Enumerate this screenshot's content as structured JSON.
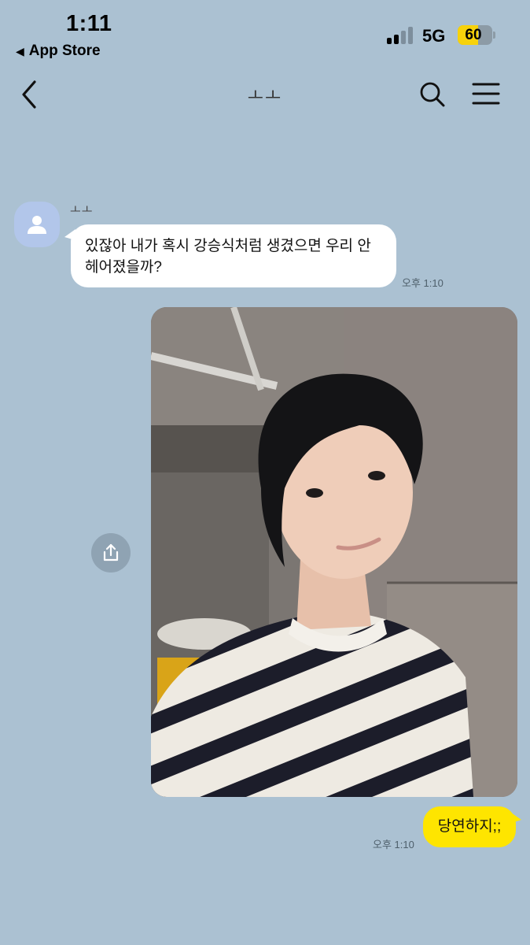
{
  "status_bar": {
    "time": "1:11",
    "back_app": "App Store",
    "network": "5G",
    "battery": "60",
    "battery_level": 0.6
  },
  "header": {
    "title": "ㅗㅗ"
  },
  "messages": [
    {
      "sender": "ㅗㅗ",
      "text": "있잖아 내가 혹시 강승식처럼 생겼으면 우리 안 헤어졌을까?",
      "time": "오후 1:10"
    },
    {
      "text": "당연하지;;",
      "time": "오후 1:10"
    }
  ],
  "icons": {
    "back": "chevron-left-icon",
    "search": "search-icon",
    "menu": "menu-icon",
    "share": "share-icon",
    "avatar": "person-icon"
  },
  "colors": {
    "chat_background": "#abc1d2",
    "outgoing_bubble": "#fee500",
    "incoming_bubble": "#ffffff",
    "avatar": "#b2c6ea"
  }
}
